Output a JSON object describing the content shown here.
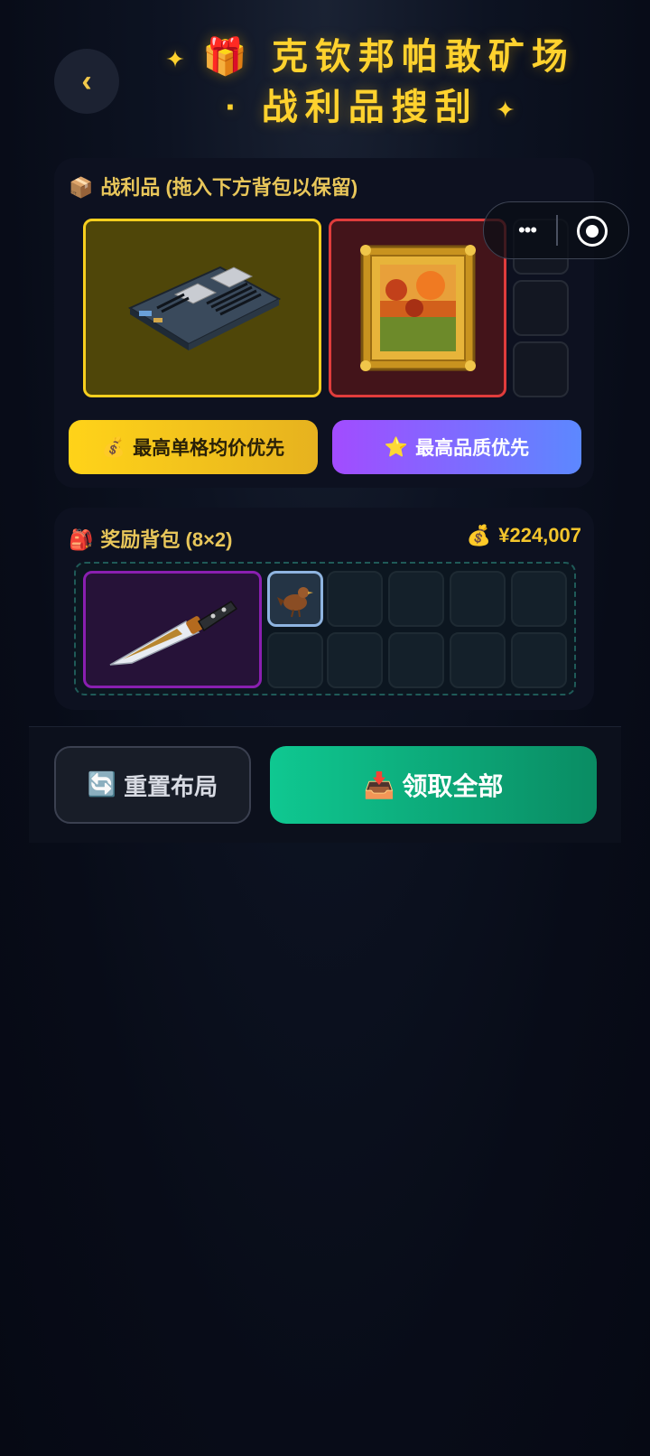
{
  "header": {
    "back_icon": "‹",
    "title_line1": "🎁 克钦邦帕敢矿场",
    "title_line2": "· 战利品搜刮",
    "sparkle": "✦"
  },
  "capsule": {
    "more_icon": "•••"
  },
  "loot": {
    "label_icon": "📦",
    "label": "战利品 (拖入下方背包以保留)",
    "items": [
      {
        "name": "server-motherboard",
        "rarity_color": "#f7cf1e"
      },
      {
        "name": "gilded-painting",
        "rarity_color": "#e03c3c"
      }
    ],
    "sort_value_icon": "💰",
    "sort_value_label": "最高单格均价优先",
    "sort_quality_icon": "⭐",
    "sort_quality_label": "最高品质优先"
  },
  "bag": {
    "label_icon": "🎒",
    "label": "奖励背包 (8×2)",
    "total_icon": "💰",
    "total_value": "¥224,007",
    "items": [
      {
        "name": "ornate-knife",
        "rarity_color": "#8a1fb0"
      },
      {
        "name": "bird-figurine",
        "rarity_color": "#8fb4e0"
      }
    ]
  },
  "actions": {
    "reset_icon": "🔄",
    "reset_label": "重置布局",
    "claim_icon": "📥",
    "claim_label": "领取全部"
  }
}
